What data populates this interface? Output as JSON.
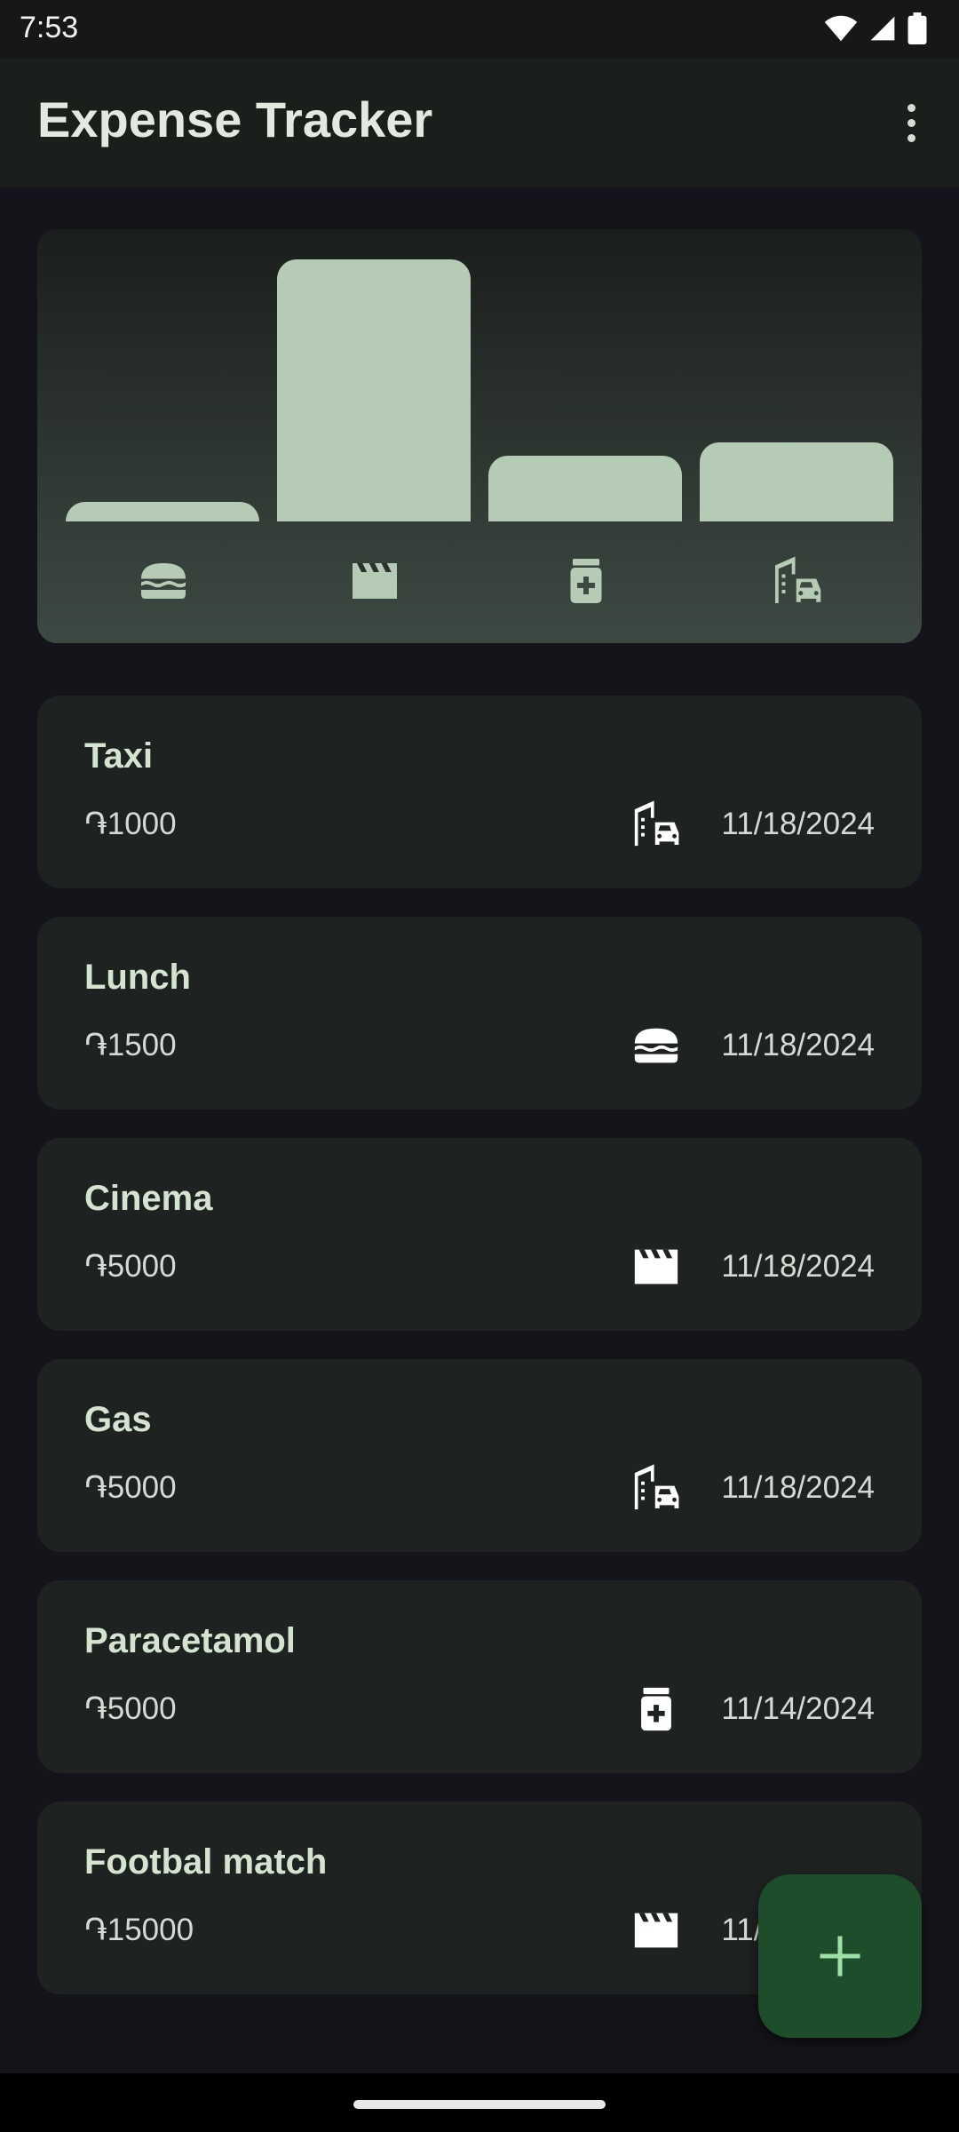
{
  "status": {
    "time": "7:53"
  },
  "app_bar": {
    "title": "Expense Tracker",
    "menu_icon": "more-vert-icon"
  },
  "chart_data": {
    "type": "bar",
    "categories": [
      "food",
      "entertainment",
      "health",
      "transport"
    ],
    "category_icons": [
      "fastfood-icon",
      "movie-icon",
      "medication-icon",
      "emoji-transportation-icon"
    ],
    "values": [
      1500,
      20000,
      5000,
      6000
    ],
    "ylim": [
      0,
      20000
    ],
    "bar_color": "#b5cbb5",
    "grid": false,
    "axis_labels_shown": false
  },
  "expenses": [
    {
      "title": "Taxi",
      "amount": "֏1000",
      "date": "11/18/2024",
      "icon": "transport"
    },
    {
      "title": "Lunch",
      "amount": "֏1500",
      "date": "11/18/2024",
      "icon": "food"
    },
    {
      "title": "Cinema",
      "amount": "֏5000",
      "date": "11/18/2024",
      "icon": "entertainment"
    },
    {
      "title": "Gas",
      "amount": "֏5000",
      "date": "11/18/2024",
      "icon": "transport"
    },
    {
      "title": "Paracetamol",
      "amount": "֏5000",
      "date": "11/14/2024",
      "icon": "health"
    },
    {
      "title": "Footbal match",
      "amount": "֏15000",
      "date": "11/18/2024",
      "icon": "entertainment"
    }
  ],
  "fab": {
    "icon": "add-icon"
  },
  "colors": {
    "background": "#14141a",
    "card": "#1e2220",
    "accent": "#1d4d2b",
    "fab_icon": "#9fe0a6"
  }
}
